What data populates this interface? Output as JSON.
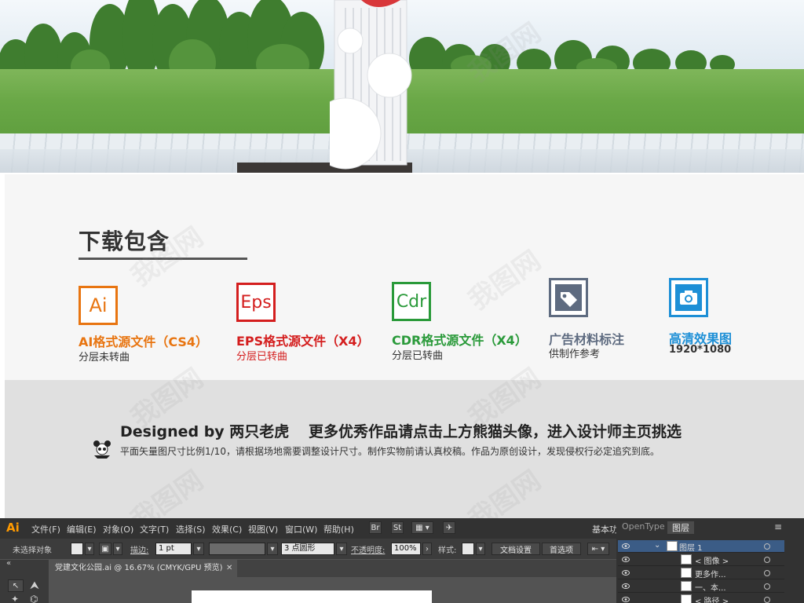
{
  "colors": {
    "ai_orange": "#e87511",
    "eps_red": "#d41e1e",
    "cdr_green": "#2a9a3a",
    "tag_gray": "#5e6b80",
    "photo_blue": "#1d8fd6"
  },
  "download": {
    "title": "下载包含",
    "items": [
      {
        "icon_text": "Ai",
        "title": "AI格式源文件（CS4）",
        "sub": "分层未转曲"
      },
      {
        "icon_text": "Eps",
        "title": "EPS格式源文件（X4）",
        "sub": "分层已转曲"
      },
      {
        "icon_text": "Cdr",
        "title": "CDR格式源文件（X4）",
        "sub": "分层已转曲"
      },
      {
        "icon": "tag-icon",
        "title": "广告材料标注",
        "sub": "供制作参考"
      },
      {
        "icon": "camera-icon",
        "title": "高清效果图",
        "sub": "1920*1080"
      }
    ]
  },
  "banner": {
    "designer": "Designed by 两只老虎",
    "promo": "更多优秀作品请点击上方熊猫头像，进入设计师主页挑选",
    "note": "平面矢量图尺寸比例1/10，请根据场地需要调整设计尺寸。制作实物前请认真校稿。作品为原创设计，发现侵权行必定追究到底。"
  },
  "illustrator": {
    "logo": "Ai",
    "menu": [
      "文件(F)",
      "编辑(E)",
      "对象(O)",
      "文字(T)",
      "选择(S)",
      "效果(C)",
      "视图(V)",
      "窗口(W)",
      "帮助(H)"
    ],
    "workspace": "基本功",
    "toolbar": {
      "selection": "未选择对象",
      "stroke_label": "描边:",
      "stroke_value": "1 pt",
      "brush_value": "3 点圆形",
      "opacity_label": "不透明度:",
      "opacity_value": "100%",
      "style_label": "样式:",
      "doc_setup": "文档设置",
      "prefs": "首选项"
    },
    "document_tab": "党建文化公园.ai @ 16.67% (CMYK/GPU 预览)",
    "panel_tabs": [
      "OpenType",
      "图层"
    ],
    "layers": [
      "图层 1",
      "< 图像 >",
      "更多作...",
      "一、本...",
      "< 路径 >"
    ]
  }
}
